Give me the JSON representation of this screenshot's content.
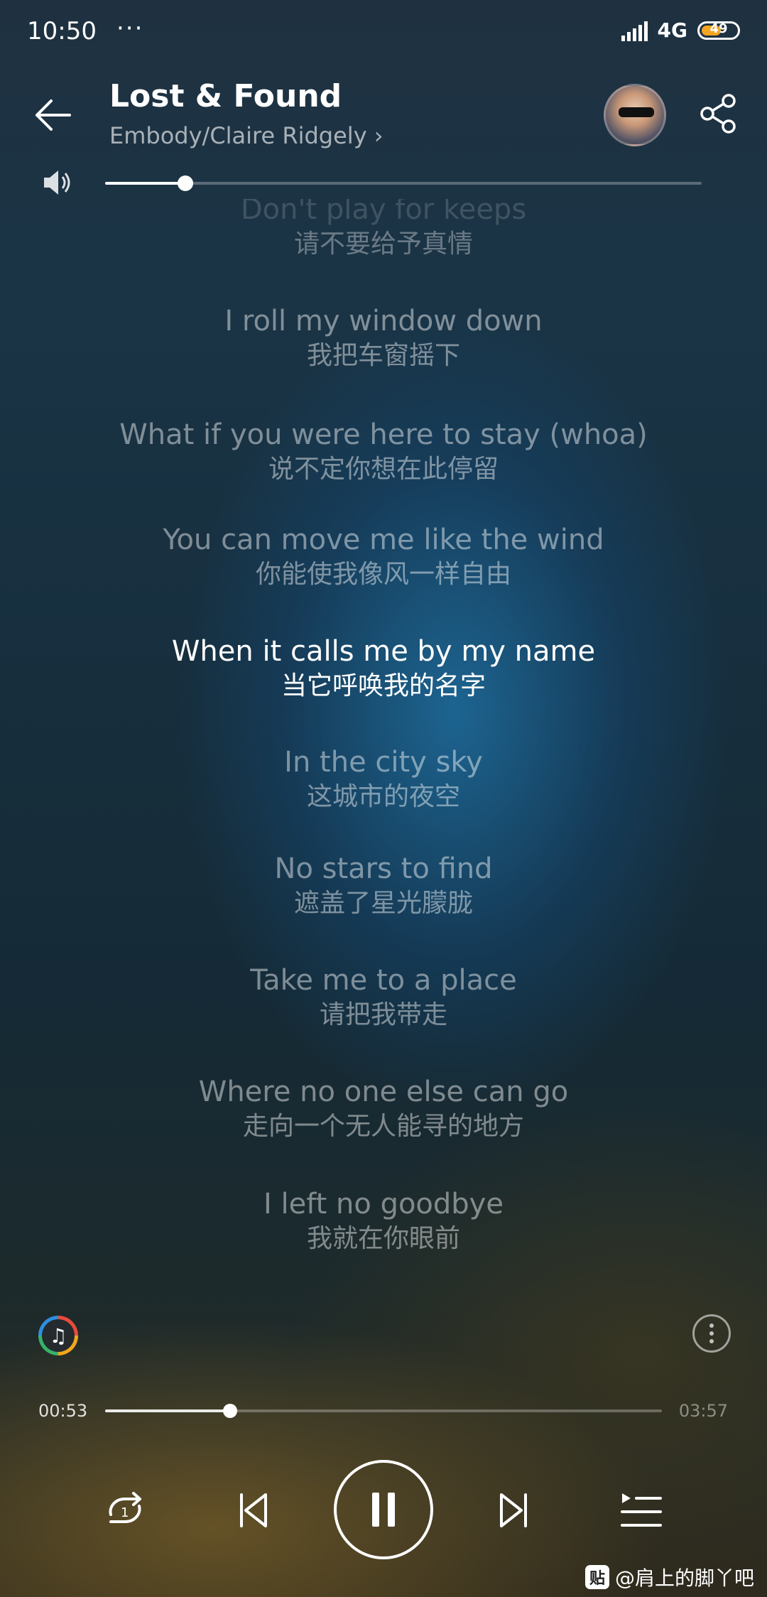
{
  "status_bar": {
    "time": "10:50",
    "dots": "···",
    "network": "4G",
    "battery": "49"
  },
  "header": {
    "title": "Lost & Found",
    "artist": "Embody/Claire Ridgely",
    "artist_chevron": "›"
  },
  "volume": {
    "level": 0.135
  },
  "lyrics": [
    {
      "en": "Don't play for keeps",
      "zh": "请不要给予真情",
      "state": "faded"
    },
    {
      "en": "I roll my window down",
      "zh": "我把车窗摇下",
      "state": "normal"
    },
    {
      "en": "What if you were here to stay (whoa)",
      "zh": "说不定你想在此停留",
      "state": "normal"
    },
    {
      "en": "You can move me like the wind",
      "zh": "你能使我像风一样自由",
      "state": "normal"
    },
    {
      "en": "When it calls me by my name",
      "zh": "当它呼唤我的名字",
      "state": "active"
    },
    {
      "en": "In the city sky",
      "zh": "这城市的夜空",
      "state": "normal"
    },
    {
      "en": "No stars to find",
      "zh": "遮盖了星光朦胧",
      "state": "normal"
    },
    {
      "en": "Take me to a place",
      "zh": "请把我带走",
      "state": "normal"
    },
    {
      "en": "Where no one else can go",
      "zh": "走向一个无人能寻的地方",
      "state": "normal"
    },
    {
      "en": "I left no goodbye",
      "zh": "我就在你眼前",
      "state": "normal"
    }
  ],
  "player": {
    "current_time": "00:53",
    "total_time": "03:57",
    "progress": 0.224,
    "sound_effect_glyph": "♫"
  },
  "watermark": {
    "logo": "贴",
    "text": "@肩上的脚丫吧"
  },
  "colors": {
    "accent_battery": "#f2a51f",
    "active_lyric": "#ffffff",
    "inactive_lyric": "rgba(255,255,255,0.45)"
  },
  "icons": [
    "back-arrow-icon",
    "share-icon",
    "volume-icon",
    "sound-effect-icon",
    "more-icon",
    "repeat-one-icon",
    "previous-icon",
    "pause-icon",
    "next-icon",
    "playlist-icon"
  ]
}
